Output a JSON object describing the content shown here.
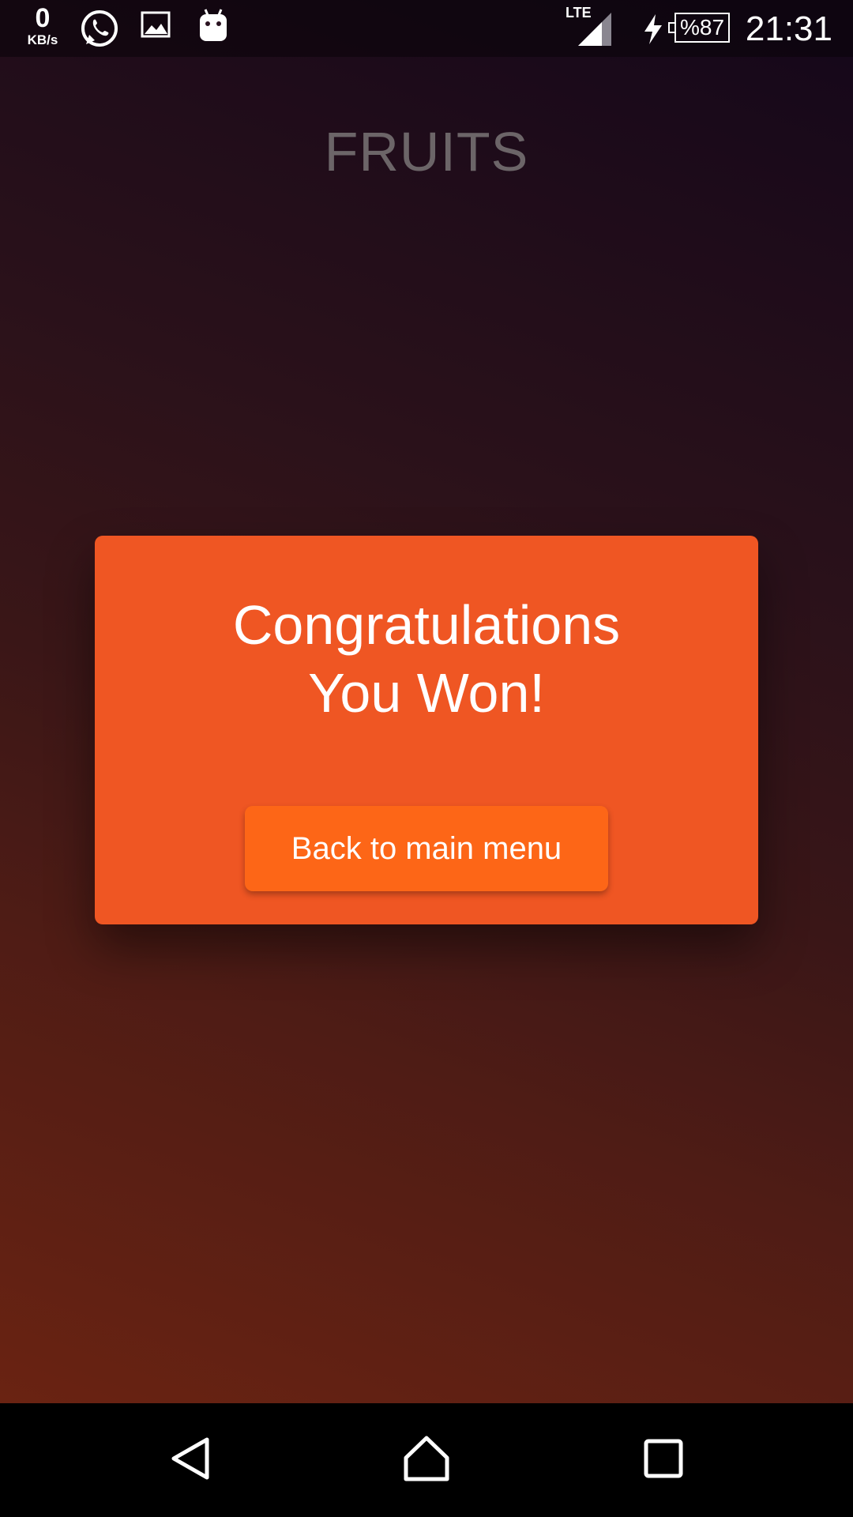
{
  "status_bar": {
    "network_speed_value": "0",
    "network_speed_unit": "KB/s",
    "network_type": "LTE",
    "battery": "%87",
    "time": "21:31",
    "icons": [
      "whatsapp-icon",
      "gallery-icon",
      "android-icon",
      "signal-icon",
      "charging-icon",
      "battery-icon"
    ]
  },
  "app": {
    "title": "FRUITS"
  },
  "dialog": {
    "line1": "Congratulations",
    "line2": "You Won!",
    "button_label": "Back to main menu"
  },
  "nav_bar": {
    "icons": [
      "back-icon",
      "home-icon",
      "recents-icon"
    ]
  },
  "colors": {
    "dialog_background": "#ef5623",
    "button_background": "#fd6617",
    "title_text": "#6c6568",
    "gradient_top": "#14071a",
    "gradient_bottom": "#6a2312"
  }
}
